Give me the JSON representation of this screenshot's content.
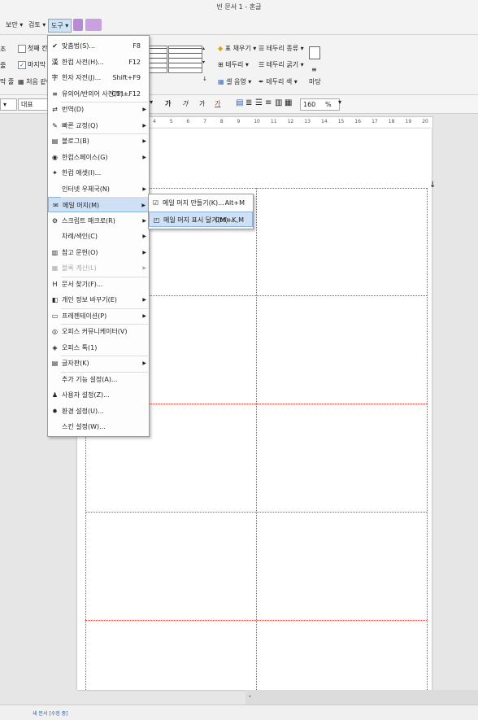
{
  "window": {
    "title": "빈 문서 1 - 혼글"
  },
  "menubar": {
    "tabs": [
      "보안",
      "검토",
      "도구"
    ]
  },
  "ribbon": {
    "left_items": [
      "조",
      "줄",
      "막 줄"
    ],
    "checks": [
      {
        "label": "첫째 칸",
        "checked": false
      },
      {
        "label": "마지막 칸",
        "checked": true
      }
    ],
    "first_cell_label": "처음 같이",
    "fill_label": "표 채우기",
    "border_label": "테두리",
    "cell_fill_label": "셀 음영",
    "border_type_label": "테두리 종류",
    "border_thickness_label": "테두리 굵기",
    "border_color_label": "테두리 색",
    "madang_label": "마당"
  },
  "formatbar": {
    "style_value": "대표",
    "zoom_value": "160",
    "zoom_unit": "%",
    "font_btns": [
      "가",
      "가",
      "가",
      "가"
    ]
  },
  "ruler": {
    "marks": [
      "4",
      "5",
      "6",
      "7",
      "8",
      "9",
      "10",
      "11",
      "12",
      "13",
      "14",
      "15",
      "16",
      "17",
      "18",
      "19",
      "20"
    ]
  },
  "menu": {
    "items": [
      {
        "icon": "✔",
        "label": "맞춤법(S)...",
        "shortcut": "F8"
      },
      {
        "icon": "漢",
        "label": "한컴 사전(H)...",
        "shortcut": "F12"
      },
      {
        "icon": "字",
        "label": "한자 자전(J)...",
        "shortcut": "Shift+F9"
      },
      {
        "icon": "≡",
        "label": "유의어/반의어 사전(T)...",
        "shortcut": "Ctrl+F12"
      },
      {
        "icon": "⇄",
        "label": "번역(D)",
        "arrow": "▶"
      },
      {
        "icon": "✎",
        "label": "빠른 교정(Q)",
        "arrow": "▶"
      },
      {
        "icon": "▤",
        "label": "블로그(B)",
        "arrow": "▶"
      },
      {
        "icon": "◉",
        "label": "한컴스페이스(G)",
        "arrow": "▶"
      },
      {
        "icon": "✦",
        "label": "한컴 애셋(I)..."
      },
      {
        "icon": "",
        "label": "인터넷 우체국(N)",
        "arrow": "▶"
      },
      {
        "icon": "✉",
        "label": "메일 머지(M)",
        "arrow": "▶",
        "highlight": true
      },
      {
        "icon": "⚙",
        "label": "스크립트 매크로(R)",
        "arrow": "▶"
      },
      {
        "icon": "",
        "label": "차례/색인(C)",
        "arrow": "▶"
      },
      {
        "icon": "▥",
        "label": "참고 문헌(O)",
        "arrow": "▶"
      },
      {
        "icon": "▦",
        "label": "블록 계산(L)",
        "arrow": "▶",
        "disabled": true
      },
      {
        "icon": "H",
        "label": "문서 찾기(F)..."
      },
      {
        "icon": "◧",
        "label": "개인 정보 바꾸기(E)",
        "arrow": "▶"
      },
      {
        "icon": "▭",
        "label": "프레젠테이션(P)",
        "arrow": "▶"
      },
      {
        "icon": "◎",
        "label": "오피스 커뮤니케이터(V)"
      },
      {
        "icon": "◈",
        "label": "오피스 톡(1)"
      },
      {
        "icon": "▤",
        "label": "글자판(K)",
        "arrow": "▶"
      },
      {
        "icon": "",
        "label": "추가 기능 설정(A)..."
      },
      {
        "icon": "♟",
        "label": "사용자 설정(Z)..."
      },
      {
        "icon": "✹",
        "label": "환경 설정(U)..."
      },
      {
        "icon": "",
        "label": "스킨 설정(W)..."
      }
    ]
  },
  "submenu": {
    "items": [
      {
        "icon": "☑",
        "label": "메일 머지 만들기(K)...",
        "shortcut": "Alt+M"
      },
      {
        "icon": "◰",
        "label": "메일 머지 표시 달기(M)...",
        "shortcut": "Ctrl+K,M",
        "highlight": true
      }
    ]
  },
  "status": {
    "text": "새 문서 [수정 중]"
  }
}
